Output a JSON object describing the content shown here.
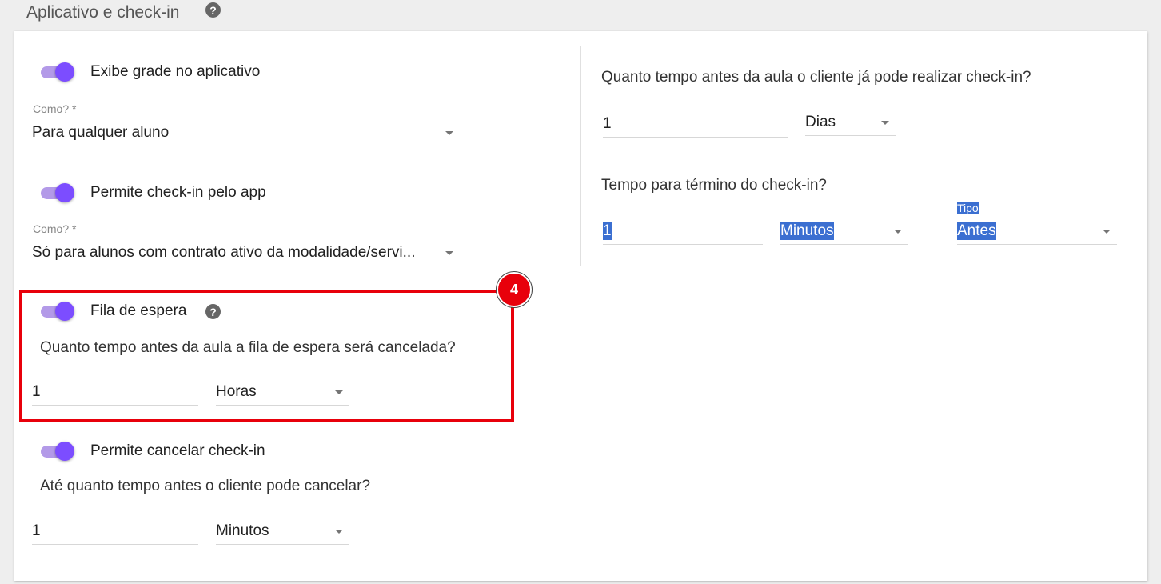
{
  "header": {
    "title": "Aplicativo e check-in",
    "help_icon": "question-circle-icon"
  },
  "left": {
    "exibe_grade": {
      "toggle_label": "Exibe grade no aplicativo",
      "enabled": true,
      "select_label": "Como? *",
      "select_value": "Para qualquer aluno"
    },
    "permite_checkin": {
      "toggle_label": "Permite check-in pelo app",
      "enabled": true,
      "select_label": "Como? *",
      "select_value": "Só para alunos com contrato ativo da modalidade/servi..."
    },
    "fila_espera": {
      "toggle_label": "Fila de espera",
      "enabled": true,
      "help_icon": "question-circle-icon",
      "question": "Quanto tempo antes da aula a fila de espera será cancelada?",
      "amount": "1",
      "unit": "Horas"
    },
    "cancelar_checkin": {
      "toggle_label": "Permite cancelar check-in",
      "enabled": true,
      "question": "Até quanto tempo antes o cliente pode cancelar?",
      "amount": "1",
      "unit": "Minutos"
    }
  },
  "right": {
    "antes_checkin": {
      "question": "Quanto tempo antes da aula o cliente já pode realizar check-in?",
      "amount": "1",
      "unit": "Dias"
    },
    "termino_checkin": {
      "question": "Tempo para término do check-in?",
      "amount": "1",
      "unit": "Minutos",
      "tipo_label": "Tipo",
      "tipo_value": "Antes"
    }
  },
  "annotation": {
    "badge_number": "4",
    "color": "#e8000b"
  },
  "colors": {
    "toggle_thumb": "#7c4dff",
    "toggle_track": "#b39ae8",
    "selection": "#3b6fd1"
  }
}
